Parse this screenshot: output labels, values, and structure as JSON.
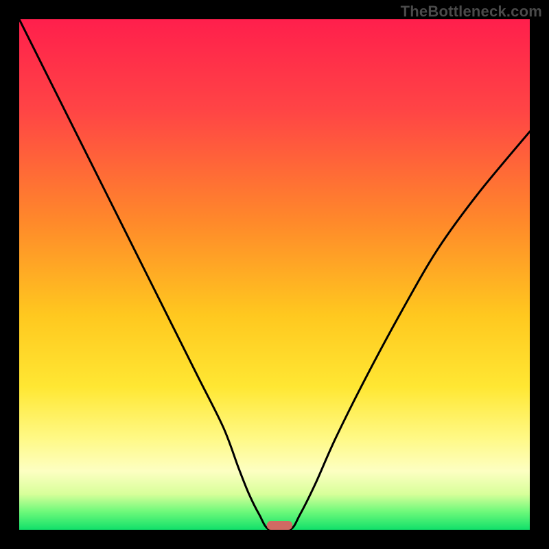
{
  "watermark": "TheBottleneck.com",
  "chart_data": {
    "type": "line",
    "title": "",
    "xlabel": "",
    "ylabel": "",
    "xlim": [
      0,
      1
    ],
    "ylim": [
      0,
      1
    ],
    "x": [
      0.0,
      0.05,
      0.1,
      0.15,
      0.2,
      0.25,
      0.3,
      0.35,
      0.4,
      0.43,
      0.45,
      0.47,
      0.49,
      0.53,
      0.55,
      0.58,
      0.62,
      0.68,
      0.75,
      0.82,
      0.9,
      1.0
    ],
    "values": [
      1.0,
      0.9,
      0.8,
      0.7,
      0.6,
      0.5,
      0.4,
      0.3,
      0.2,
      0.12,
      0.07,
      0.03,
      0.0,
      0.0,
      0.03,
      0.09,
      0.18,
      0.3,
      0.43,
      0.55,
      0.66,
      0.78
    ],
    "marker": {
      "x0": 0.485,
      "x1": 0.535,
      "y": 0.0
    },
    "gradient_stops": [
      {
        "offset": 0.0,
        "color": "#ff1f4c"
      },
      {
        "offset": 0.18,
        "color": "#ff4545"
      },
      {
        "offset": 0.4,
        "color": "#ff8a2a"
      },
      {
        "offset": 0.58,
        "color": "#ffc81f"
      },
      {
        "offset": 0.72,
        "color": "#ffe733"
      },
      {
        "offset": 0.82,
        "color": "#fff985"
      },
      {
        "offset": 0.885,
        "color": "#fdffc2"
      },
      {
        "offset": 0.93,
        "color": "#d8ff9a"
      },
      {
        "offset": 0.965,
        "color": "#6cf97a"
      },
      {
        "offset": 1.0,
        "color": "#11e06a"
      }
    ],
    "curve_color": "#000000",
    "marker_color": "#d06a63"
  }
}
